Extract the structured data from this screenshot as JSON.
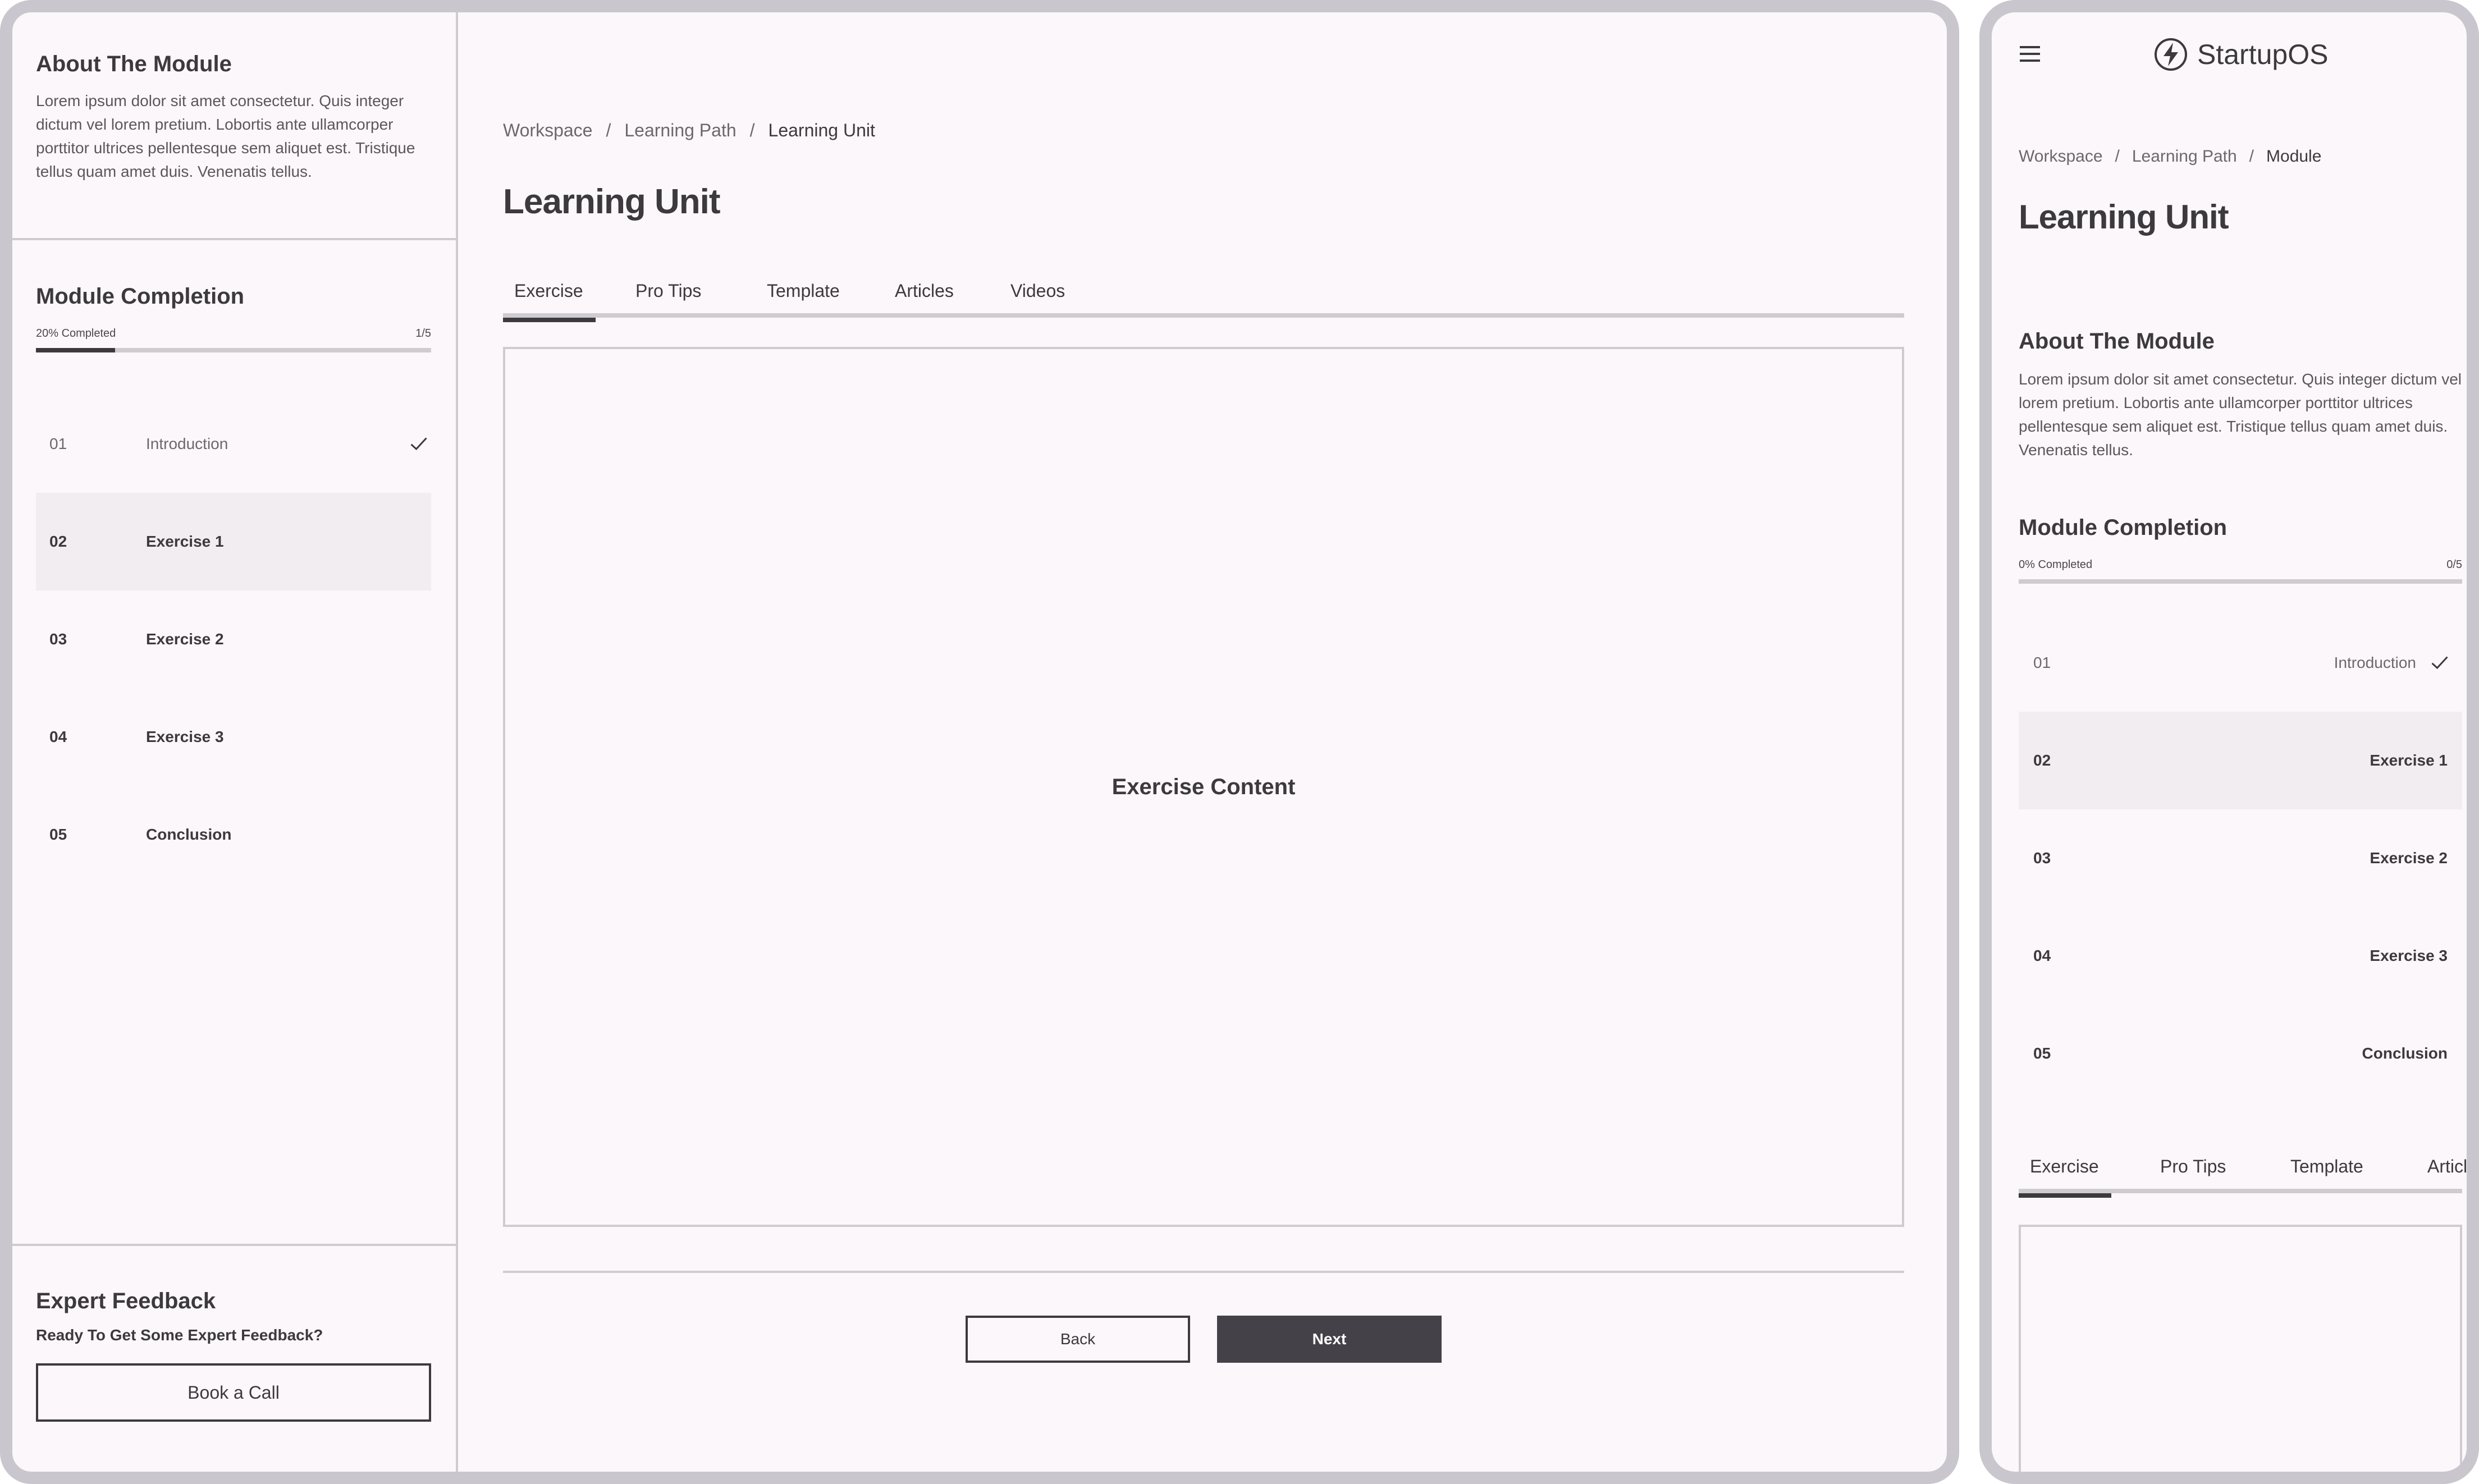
{
  "desktop": {
    "sidebar": {
      "about": {
        "title": "About The Module",
        "body": "Lorem ipsum dolor sit amet consectetur. Quis integer dictum vel lorem pretium. Lobortis ante ullamcorper porttitor ultrices pellentesque sem aliquet est. Tristique tellus quam amet duis. Venenatis tellus."
      },
      "completion": {
        "title": "Module Completion",
        "progress_label": "20% Completed",
        "progress_count": "1/5",
        "progress_fraction": 0.2,
        "items": [
          {
            "num": "01",
            "label": "Introduction",
            "done": true,
            "active": false
          },
          {
            "num": "02",
            "label": "Exercise 1",
            "done": false,
            "active": true
          },
          {
            "num": "03",
            "label": "Exercise 2",
            "done": false,
            "active": false
          },
          {
            "num": "04",
            "label": "Exercise 3",
            "done": false,
            "active": false
          },
          {
            "num": "05",
            "label": "Conclusion",
            "done": false,
            "active": false
          }
        ]
      },
      "feedback": {
        "title": "Expert Feedback",
        "subtitle": "Ready To Get Some Expert Feedback?",
        "button": "Book a Call"
      }
    },
    "main": {
      "breadcrumb": [
        "Workspace",
        "/",
        "Learning Path",
        "/",
        "Learning Unit"
      ],
      "title": "Learning Unit",
      "tabs": [
        "Exercise",
        "Pro Tips",
        "Template",
        "Articles",
        "Videos"
      ],
      "active_tab": "Exercise",
      "content_label": "Exercise Content",
      "back_button": "Back",
      "next_button": "Next"
    }
  },
  "mobile": {
    "app_name": "StartupOS",
    "breadcrumb": [
      "Workspace",
      "/",
      "Learning Path",
      "/",
      "Module"
    ],
    "title": "Learning Unit",
    "about": {
      "title": "About The Module",
      "body": "Lorem ipsum dolor sit amet consectetur. Quis integer dictum vel lorem pretium. Lobortis ante ullamcorper porttitor ultrices pellentesque sem aliquet est. Tristique tellus quam amet duis. Venenatis tellus."
    },
    "completion": {
      "title": "Module Completion",
      "progress_label": "0% Completed",
      "progress_count": "0/5",
      "progress_fraction": 0,
      "items": [
        {
          "num": "01",
          "label": "Introduction",
          "done": true,
          "active": false
        },
        {
          "num": "02",
          "label": "Exercise 1",
          "done": false,
          "active": true
        },
        {
          "num": "03",
          "label": "Exercise 2",
          "done": false,
          "active": false
        },
        {
          "num": "04",
          "label": "Exercise 3",
          "done": false,
          "active": false
        },
        {
          "num": "05",
          "label": "Conclusion",
          "done": false,
          "active": false
        }
      ]
    },
    "tabs": [
      "Exercise",
      "Pro Tips",
      "Template",
      "Article"
    ],
    "active_tab": "Exercise"
  },
  "colors": {
    "background": "#fcf7fa",
    "frame": "#c9c7cd",
    "text": "#3c393f",
    "muted_text": "#6b686e",
    "active_row": "#f1edf0",
    "primary_button": "#454148"
  },
  "icons": [
    "check-icon",
    "menu-icon",
    "lightning-logo-icon"
  ]
}
